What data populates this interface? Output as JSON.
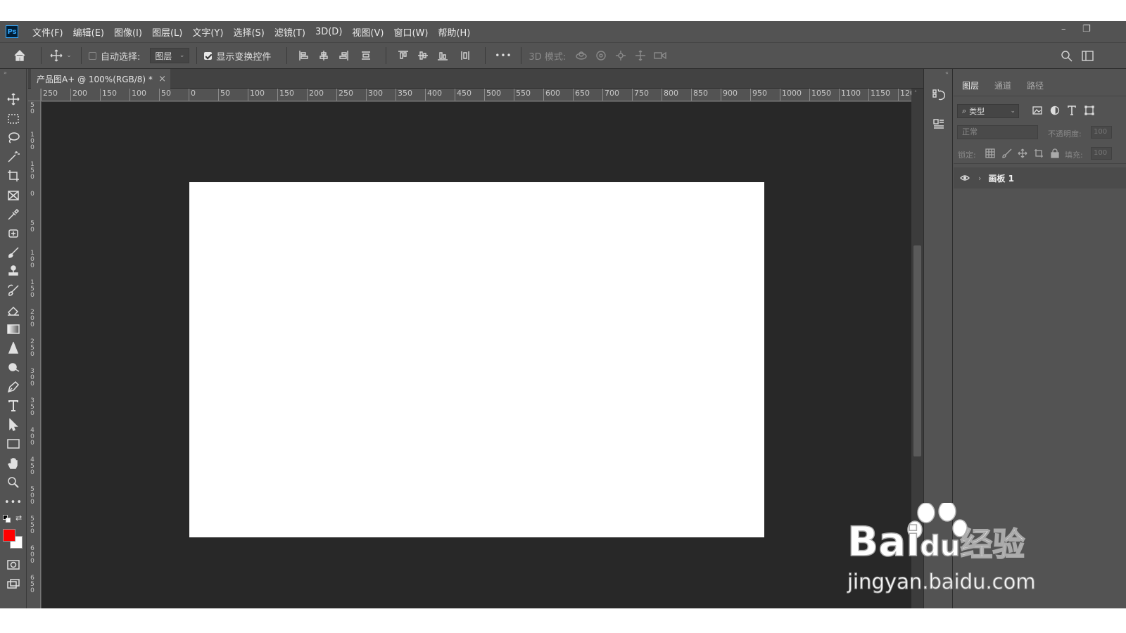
{
  "app": {
    "logo": "Ps"
  },
  "menu": [
    "文件(F)",
    "编辑(E)",
    "图像(I)",
    "图层(L)",
    "文字(Y)",
    "选择(S)",
    "滤镜(T)",
    "3D(D)",
    "视图(V)",
    "窗口(W)",
    "帮助(H)"
  ],
  "window_controls": {
    "minimize": "–",
    "restore": "❐"
  },
  "options_bar": {
    "auto_select_label": "自动选择:",
    "auto_select_checked": false,
    "auto_select_target": "图层",
    "show_transform_label": "显示变换控件",
    "show_transform_checked": true,
    "more": "•••",
    "mode_3d_label": "3D 模式:"
  },
  "tools": [
    "move-tool",
    "rect-marquee-tool",
    "lasso-tool",
    "magic-wand-tool",
    "crop-tool",
    "frame-tool",
    "eyedropper-tool",
    "healing-brush-tool",
    "brush-tool",
    "clone-stamp-tool",
    "history-brush-tool",
    "eraser-tool",
    "gradient-tool",
    "blur-tool",
    "dodge-tool",
    "pen-tool",
    "type-tool",
    "path-selection-tool",
    "rectangle-tool",
    "hand-tool",
    "zoom-tool",
    "edit-toolbar"
  ],
  "colors": {
    "foreground": "#ff0000",
    "background": "#ffffff",
    "accent": "#31a8ff"
  },
  "document": {
    "tab_title": "产品图A+ @ 100%(RGB/8) *",
    "close": "×"
  },
  "ruler_top_labels": [
    "250",
    "200",
    "150",
    "100",
    "50",
    "0",
    "50",
    "100",
    "150",
    "200",
    "250",
    "300",
    "350",
    "400",
    "450",
    "500",
    "550",
    "600",
    "650",
    "700",
    "750",
    "800",
    "850",
    "900",
    "950",
    "1000",
    "1050",
    "1100",
    "1150",
    "120"
  ],
  "ruler_left_labels": [
    "5 0",
    "1 0 0",
    "1 5 0",
    "0",
    "5 0",
    "1 0 0",
    "1 5 0",
    "2 0 0",
    "2 5 0",
    "3 0 0",
    "3 5 0",
    "4 0 0",
    "4 5 0",
    "5 0 0",
    "5 5 0",
    "6 0 0",
    "6 5 0"
  ],
  "layers_panel": {
    "tabs": [
      "图层",
      "通道",
      "路径"
    ],
    "active_tab": "图层",
    "filter_kind": "类型",
    "blend_mode": "正常",
    "opacity_label": "不透明度:",
    "opacity_value": "100",
    "lock_label": "锁定:",
    "fill_label": "填充:",
    "fill_value": "100",
    "layers": [
      {
        "name": "画板 1",
        "visible": true,
        "type": "artboard",
        "expanded": false
      }
    ]
  },
  "watermark": {
    "brand_left": "Bai",
    "brand_mid": "du",
    "brand_right": "经验",
    "url": "jingyan.baidu.com"
  }
}
